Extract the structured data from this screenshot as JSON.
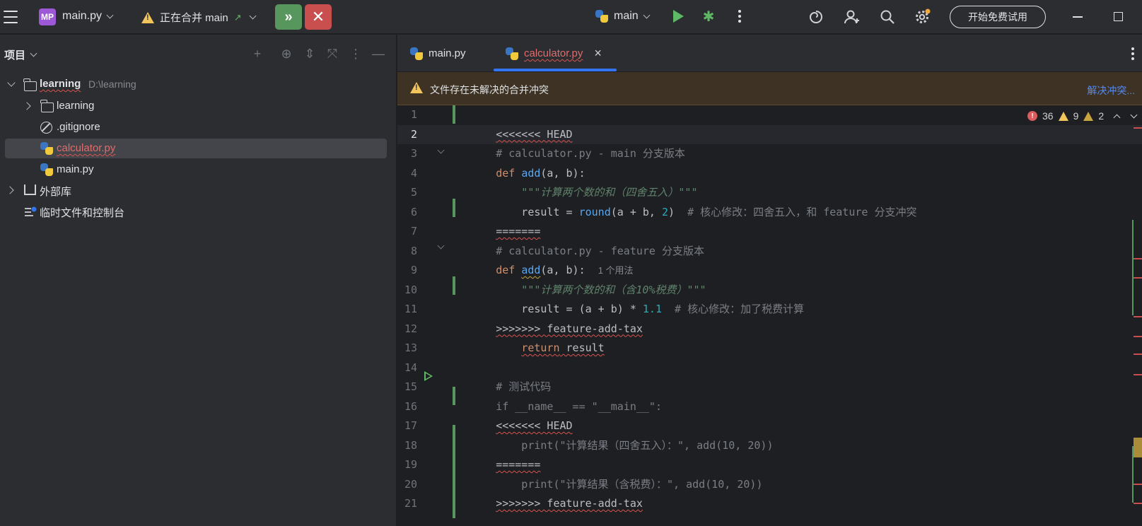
{
  "titlebar": {
    "project_badge": "MP",
    "project_name": "main.py",
    "merge_status": "正在合并 main",
    "merge_arrow": "↗",
    "run_config": "main",
    "trial_button": "开始免费试用",
    "icons": [
      "menu-icon",
      "accept-merge-icon",
      "abort-merge-icon",
      "python-icon",
      "run-icon",
      "debug-icon",
      "more-icon",
      "ai-spiral-icon",
      "add-user-icon",
      "search-icon",
      "settings-icon",
      "minimize-icon",
      "maximize-icon"
    ]
  },
  "project_panel": {
    "title": "项目",
    "tree": [
      {
        "label": "learning",
        "path": "D:\\learning",
        "type": "folder",
        "expanded": true
      },
      {
        "label": "learning",
        "type": "folder",
        "expanded": false
      },
      {
        "label": ".gitignore",
        "type": "ignore"
      },
      {
        "label": "calculator.py",
        "type": "python",
        "selected": true,
        "conflict": true
      },
      {
        "label": "main.py",
        "type": "python"
      },
      {
        "label": "外部库",
        "type": "library",
        "expanded": false
      },
      {
        "label": "临时文件和控制台",
        "type": "scratch"
      }
    ]
  },
  "editor": {
    "tabs": [
      {
        "label": "main.py",
        "active": false
      },
      {
        "label": "calculator.py",
        "active": true,
        "close": "×"
      }
    ],
    "banner": {
      "text": "文件存在未解决的合并冲突",
      "link": "解决冲突..."
    },
    "inspections": {
      "errors": "36",
      "warnings": "9",
      "weak_warnings": "2"
    },
    "current_line": 2,
    "line_numbers": [
      "1",
      "2",
      "3",
      "4",
      "5",
      "6",
      "7",
      "8",
      "9",
      "10",
      "11",
      "12",
      "13",
      "14",
      "15",
      "16",
      "17",
      "18",
      "19",
      "20",
      "21"
    ],
    "lines": [
      {
        "t1": "<<<<<<< HEAD"
      },
      {
        "t1": "# calculator.py - main 分支版本"
      },
      {
        "t1": "def",
        "t2": "add",
        "t3": "(a, b):"
      },
      {
        "t1": "    \"\"\"计算两个数的和（四舍五入）\"\"\""
      },
      {
        "t1": "    result = ",
        "t2": "round",
        "t3": "(a + b, ",
        "t4": "2",
        "t5": ")  ",
        "t6": "# 核心修改：四舍五入，和 feature 分支冲突"
      },
      {
        "t1": "======="
      },
      {
        "t1": "# calculator.py - feature 分支版本"
      },
      {
        "t1": "def",
        "t2": "add",
        "t3": "(a, b):",
        "hint": "1 个用法"
      },
      {
        "t1": "    \"\"\"计算两个数的和（含10%税费）\"\"\""
      },
      {
        "t1": "    result = (a + b) * ",
        "t2": "1.1",
        "t3": "  # 核心修改：加了税费计算"
      },
      {
        "t1": ">>>>>>> feature-add-tax"
      },
      {
        "t1": "    ",
        "t2": "return",
        "t3": " result"
      },
      {
        "t1": ""
      },
      {
        "t1": "# 测试代码"
      },
      {
        "t1": "if __name__ == \"__main__\":"
      },
      {
        "t1": "<<<<<<< HEAD"
      },
      {
        "t1": "    print(\"计算结果（四舍五入）：\", add(10, 20))"
      },
      {
        "t1": "======="
      },
      {
        "t1": "    print(\"计算结果（含税费）：\", add(10, 20))"
      },
      {
        "t1": ">>>>>>> feature-add-tax"
      },
      {
        "t1": ""
      }
    ]
  },
  "colors": {
    "accent": "#3574f0",
    "conflict_bar": "#57965c",
    "error": "#db5c5c",
    "warning": "#f2c55c"
  }
}
